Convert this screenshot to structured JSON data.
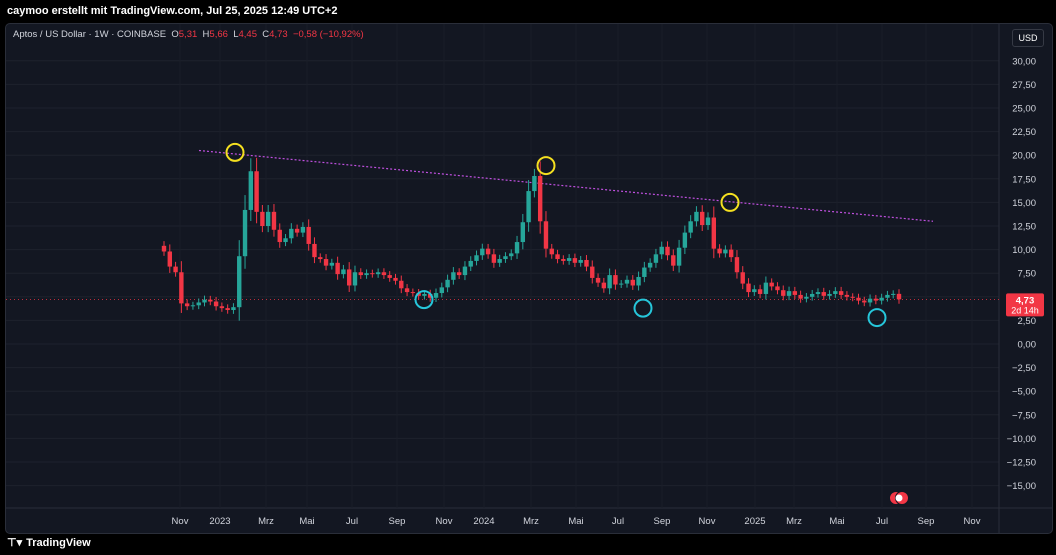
{
  "header": {
    "title": "caymoo erstellt mit TradingView.com, Jul 25, 2025 12:49 UTC+2"
  },
  "legend": {
    "symbol": "Aptos / US Dollar · 1W · COINBASE",
    "open_label": "O",
    "open": "5,31",
    "high_label": "H",
    "high": "5,66",
    "low_label": "L",
    "low": "4,45",
    "close_label": "C",
    "close": "4,73",
    "change": "−0,58 (−10,92%)"
  },
  "currency_button": "USD",
  "price_badge": {
    "value": "4,73",
    "countdown": "2d 14h"
  },
  "footer": {
    "brand": "TradingView"
  },
  "colors": {
    "up": "#26a69a",
    "down": "#f23645",
    "trendline": "#c050e0",
    "peak_marker": "#f5e020",
    "trough_marker": "#26c6da",
    "background": "#131722"
  },
  "chart_data": {
    "type": "candlestick",
    "instrument": "Aptos / US Dollar",
    "timeframe": "1W",
    "exchange": "COINBASE",
    "y_ticks": [
      "30,00",
      "27,50",
      "25,00",
      "22,50",
      "20,00",
      "17,50",
      "15,00",
      "12,50",
      "10,00",
      "7,50",
      "5,00",
      "2,50",
      "0,00",
      "−2,50",
      "−5,00",
      "−7,50",
      "−10,00",
      "−12,50",
      "−15,00"
    ],
    "x_labels": [
      "Nov",
      "2023",
      "Mrz",
      "Mai",
      "Jul",
      "Sep",
      "Nov",
      "2024",
      "Mrz",
      "Mai",
      "Jul",
      "Sep",
      "Nov",
      "2025",
      "Mrz",
      "Mai",
      "Jul",
      "Sep",
      "Nov"
    ],
    "ylim": [
      -17.5,
      32
    ],
    "current_price": 4.73,
    "closes": [
      9.8,
      8.2,
      7.6,
      4.3,
      4.0,
      4.1,
      4.4,
      4.7,
      4.5,
      4.0,
      3.8,
      3.6,
      3.9,
      9.3,
      14.2,
      18.3,
      14.0,
      12.5,
      14.0,
      12.1,
      10.8,
      11.2,
      12.2,
      11.8,
      12.4,
      10.6,
      9.2,
      9.0,
      8.3,
      8.6,
      7.4,
      7.9,
      6.2,
      7.6,
      7.3,
      7.5,
      7.4,
      7.6,
      7.3,
      7.0,
      6.7,
      5.9,
      5.5,
      5.4,
      5.1,
      5.3,
      4.9,
      5.4,
      6.0,
      6.8,
      7.6,
      7.3,
      8.2,
      8.8,
      9.4,
      10.1,
      9.5,
      8.6,
      9.0,
      9.3,
      9.6,
      10.8,
      12.9,
      16.2,
      17.8,
      13.0,
      10.1,
      9.5,
      9.0,
      8.8,
      9.1,
      8.6,
      8.9,
      8.2,
      7.0,
      6.5,
      5.9,
      7.3,
      6.3,
      6.4,
      6.8,
      6.2,
      7.1,
      8.1,
      8.6,
      9.5,
      10.3,
      9.4,
      8.3,
      10.2,
      11.8,
      13.0,
      14.0,
      12.6,
      13.4,
      10.1,
      9.6,
      10.0,
      9.2,
      7.6,
      6.4,
      5.5,
      5.8,
      5.3,
      6.5,
      6.1,
      5.7,
      5.1,
      5.6,
      5.2,
      4.8,
      5.0,
      5.3,
      5.5,
      5.1,
      5.3,
      5.6,
      5.2,
      5.0,
      4.9,
      4.6,
      4.4,
      4.8,
      4.6,
      4.9,
      5.2,
      5.31,
      4.73
    ],
    "markers": {
      "peaks": [
        {
          "date": "2023-01",
          "value": 20.3
        },
        {
          "date": "2024-03",
          "value": 18.9
        },
        {
          "date": "2024-12",
          "value": 15.0
        }
      ],
      "troughs": [
        {
          "date": "2023-10",
          "value": 4.7
        },
        {
          "date": "2024-08",
          "value": 3.8
        },
        {
          "date": "2025-06",
          "value": 2.8
        }
      ]
    },
    "trendline": {
      "from": {
        "date": "2022-12",
        "value": 20.5
      },
      "to": {
        "date": "2025-10",
        "value": 13.0
      }
    }
  }
}
